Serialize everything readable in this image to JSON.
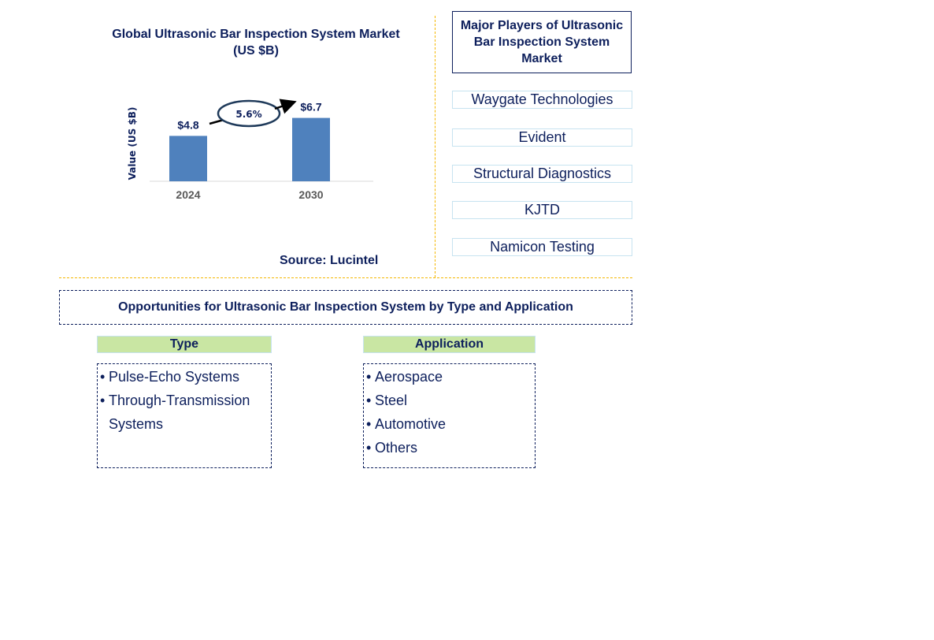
{
  "chart_data": {
    "type": "bar",
    "title": "Global Ultrasonic Bar Inspection System Market",
    "subtitle": "(US $B)",
    "categories": [
      "2024",
      "2030"
    ],
    "values": [
      4.8,
      6.7
    ],
    "data_labels": [
      "$4.8",
      "$6.7"
    ],
    "xlabel": "",
    "ylabel": "Value (US $B)",
    "ylim": [
      0,
      7.5
    ],
    "grid": false,
    "bar_color": "#4f81bd",
    "annotation": {
      "type": "cagr-arrow",
      "label": "5.6%"
    }
  },
  "source": "Source: Lucintel",
  "players": {
    "title": "Major Players of Ultrasonic Bar Inspection System Market",
    "items": [
      "Waygate Technologies",
      "Evident",
      "Structural Diagnostics",
      "KJTD",
      "Namicon Testing"
    ]
  },
  "opportunities": {
    "title": "Opportunities for Ultrasonic Bar Inspection System by Type and Application",
    "type": {
      "header": "Type",
      "items": [
        "Pulse-Echo Systems",
        "Through-Transmission Systems"
      ]
    },
    "application": {
      "header": "Application",
      "items": [
        "Aerospace",
        "Steel",
        "Automotive",
        "Others"
      ]
    }
  },
  "colors": {
    "text": "#0d1f5c",
    "bar": "#4f81bd",
    "divider": "#f5b700",
    "category_header_bg": "#c9e6a3",
    "player_border": "#c7e3f0"
  }
}
